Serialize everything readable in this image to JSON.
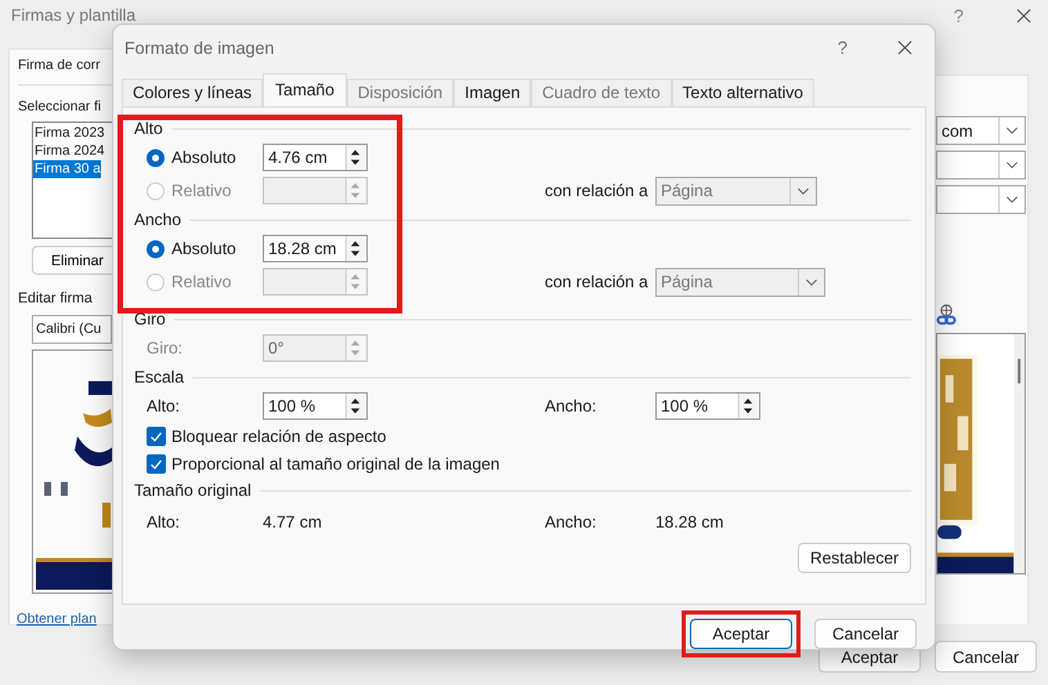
{
  "back_window": {
    "title": "Firmas y plantilla",
    "help_label": "?",
    "left": {
      "section_title": "Firma de corr",
      "select_label": "Seleccionar fi",
      "signatures": [
        {
          "label": "Firma 2023",
          "selected": false
        },
        {
          "label": "Firma 2024",
          "selected": false
        },
        {
          "label": "Firma 30 a",
          "selected": true
        }
      ],
      "delete_button": "Eliminar",
      "edit_label": "Editar firma",
      "font_value": "Calibri (Cu",
      "template_link": "Obtener plan"
    },
    "right": {
      "address_value": "com"
    },
    "buttons": [
      "Aceptar",
      "Cancelar"
    ]
  },
  "dialog": {
    "title": "Formato de imagen",
    "help_label": "?",
    "tabs": [
      {
        "label": "Colores y líneas",
        "selected": false,
        "disabled": false
      },
      {
        "label": "Tamaño",
        "selected": true,
        "disabled": false
      },
      {
        "label": "Disposición",
        "selected": false,
        "disabled": true
      },
      {
        "label": "Imagen",
        "selected": false,
        "disabled": false
      },
      {
        "label": "Cuadro de texto",
        "selected": false,
        "disabled": true
      },
      {
        "label": "Texto alternativo",
        "selected": false,
        "disabled": false
      }
    ],
    "size_highlighted": true,
    "size_groups": [
      {
        "title": "Alto",
        "absolute_label": "Absoluto",
        "absolute_value": "4.76 cm",
        "absolute_selected": true,
        "relative_label": "Relativo",
        "relative_selected": false,
        "relation_label": "con relación a",
        "relation_value": "Página"
      },
      {
        "title": "Ancho",
        "absolute_label": "Absoluto",
        "absolute_value": "18.28 cm",
        "absolute_selected": true,
        "relative_label": "Relativo",
        "relative_selected": false,
        "relation_label": "con relación a",
        "relation_value": "Página"
      }
    ],
    "rotation": {
      "title": "Giro",
      "label": "Giro:",
      "value": "0°",
      "disabled": true
    },
    "scale": {
      "title": "Escala",
      "height_label": "Alto:",
      "height_value": "100 %",
      "width_label": "Ancho:",
      "width_value": "100 %",
      "options": [
        {
          "label": "Bloquear relación de aspecto",
          "checked": true
        },
        {
          "label": "Proporcional al tamaño original de la imagen",
          "checked": true
        }
      ]
    },
    "original": {
      "title": "Tamaño original",
      "height_label": "Alto:",
      "height_value": "4.77 cm",
      "width_label": "Ancho:",
      "width_value": "18.28 cm"
    },
    "reset_button": "Restablecer",
    "buttons": [
      {
        "label": "Aceptar",
        "highlighted": true,
        "default": true
      },
      {
        "label": "Cancelar",
        "highlighted": false,
        "default": false
      }
    ]
  }
}
